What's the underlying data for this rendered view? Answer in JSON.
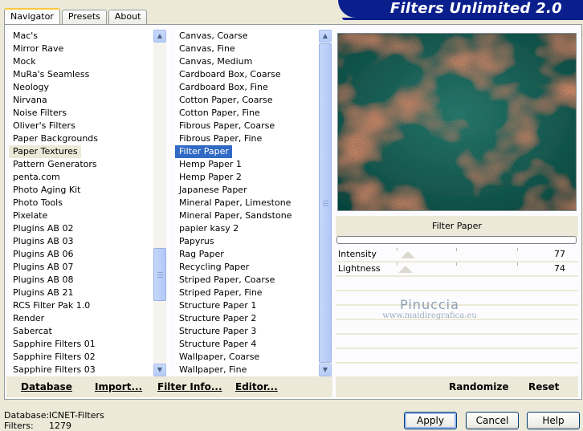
{
  "window": {
    "brand_title": "Filters Unlimited 2.0"
  },
  "tabs": [
    {
      "label": "Navigator",
      "active": true
    },
    {
      "label": "Presets",
      "active": false
    },
    {
      "label": "About",
      "active": false
    }
  ],
  "categories": {
    "selected": "Paper Textures",
    "items": [
      "Mac's",
      "Mirror Rave",
      "Mock",
      "MuRa's Seamless",
      "Neology",
      "Nirvana",
      "Noise Filters",
      "Oliver's Filters",
      "Paper Backgrounds",
      "Paper Textures",
      "Pattern Generators",
      "penta.com",
      "Photo Aging Kit",
      "Photo Tools",
      "Pixelate",
      "Plugins AB 02",
      "Plugins AB 03",
      "Plugins AB 06",
      "Plugins AB 07",
      "Plugins AB 08",
      "Plugins AB 21",
      "RCS Filter Pak 1.0",
      "Render",
      "Sabercat",
      "Sapphire Filters 01",
      "Sapphire Filters 02",
      "Sapphire Filters 03"
    ]
  },
  "filters": {
    "selected": "Filter Paper",
    "items": [
      "Canvas, Coarse",
      "Canvas, Fine",
      "Canvas, Medium",
      "Cardboard Box, Coarse",
      "Cardboard Box, Fine",
      "Cotton Paper, Coarse",
      "Cotton Paper, Fine",
      "Fibrous Paper, Coarse",
      "Fibrous Paper, Fine",
      "Filter Paper",
      "Hemp Paper 1",
      "Hemp Paper 2",
      "Japanese Paper",
      "Mineral Paper, Limestone",
      "Mineral Paper, Sandstone",
      "papier kasy 2",
      "Papyrus",
      "Rag Paper",
      "Recycling Paper",
      "Striped Paper, Coarse",
      "Striped Paper, Fine",
      "Structure Paper 1",
      "Structure Paper 2",
      "Structure Paper 3",
      "Structure Paper 4",
      "Wallpaper, Coarse",
      "Wallpaper, Fine"
    ]
  },
  "left_buttons": {
    "database": "Database",
    "import": "Import...",
    "filter_info": "Filter Info...",
    "editor": "Editor..."
  },
  "preview": {
    "filter_name": "Filter Paper"
  },
  "controls": [
    {
      "label": "Intensity",
      "value": "77"
    },
    {
      "label": "Lightness",
      "value": "74"
    }
  ],
  "right_buttons": {
    "randomize": "Randomize",
    "reset": "Reset"
  },
  "watermark": {
    "name": "Pinuccia",
    "url": "www.maidiregrafica.eu"
  },
  "status": {
    "database_label": "Database:",
    "database_value": "ICNET-Filters",
    "filters_label": "Filters:",
    "filters_value": "1279"
  },
  "dialog_buttons": {
    "apply": "Apply",
    "cancel": "Cancel",
    "help": "Help"
  }
}
